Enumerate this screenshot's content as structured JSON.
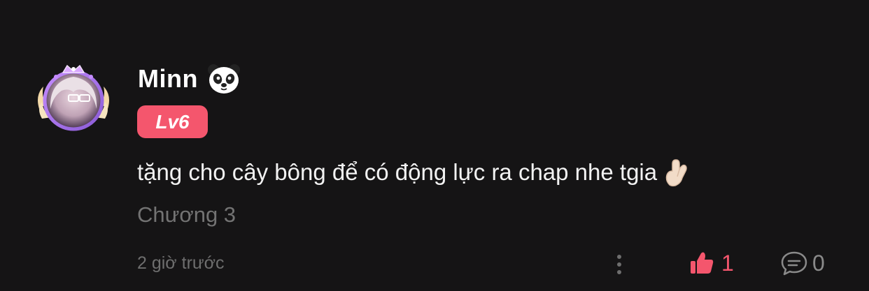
{
  "comment": {
    "username": "Minn",
    "username_emoji": "panda-icon",
    "level_badge": "Lv6",
    "text": "tặng cho cây bông để có động lực ra chap nhe tgia",
    "text_emoji": "hand-with-index-and-middle-fingers-crossed-icon",
    "chapter": "Chương 3",
    "time": "2 giờ trước",
    "like_count": "1",
    "reply_count": "0"
  },
  "colors": {
    "background": "#151415",
    "accent": "#f4566d",
    "muted_text": "#737373"
  }
}
